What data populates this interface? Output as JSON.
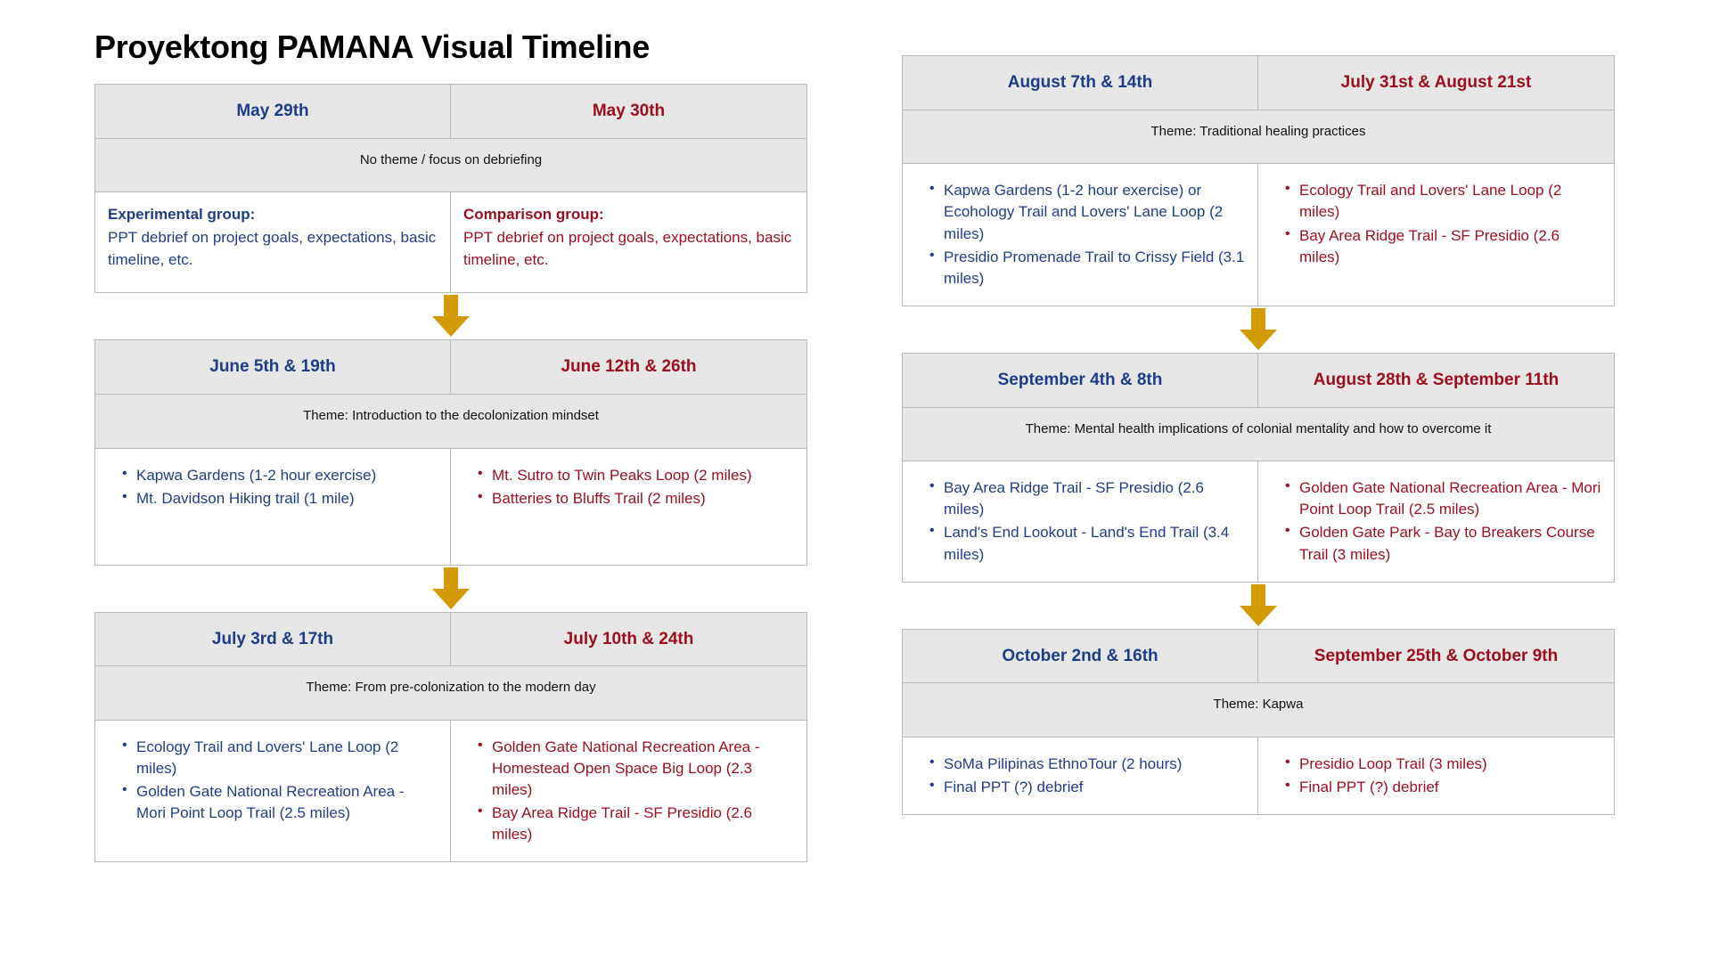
{
  "title": "Proyektong PAMANA Visual Timeline",
  "colors": {
    "experimental": "#1f3d87",
    "comparison": "#9c0d1e",
    "arrow": "#d29a05",
    "header_bg": "#e6e6e6",
    "border": "#b9b9b9"
  },
  "left_column": {
    "blocks": [
      {
        "header_experimental": "May 29th",
        "header_comparison": "May 30th",
        "theme": "No theme / focus on debriefing",
        "experimental_lead": "Experimental group:",
        "experimental_text": "PPT debrief on project goals, expectations, basic timeline, etc.",
        "comparison_lead": "Comparison group:",
        "comparison_text": "PPT debrief on project goals, expectations, basic timeline, etc."
      },
      {
        "header_experimental": "June 5th & 19th",
        "header_comparison": "June 12th & 26th",
        "theme": "Theme: Introduction to the decolonization mindset",
        "experimental_items": [
          "Kapwa Gardens (1-2 hour exercise)",
          "Mt. Davidson Hiking trail (1 mile)"
        ],
        "comparison_items": [
          "Mt. Sutro to Twin Peaks Loop (2 miles)",
          "Batteries to Bluffs Trail (2 miles)"
        ]
      },
      {
        "header_experimental": "July 3rd & 17th",
        "header_comparison": "July 10th & 24th",
        "theme": "Theme: From pre-colonization to the modern day",
        "experimental_items": [
          "Ecology Trail and Lovers' Lane Loop (2 miles)",
          "Golden Gate National Recreation Area - Mori Point Loop Trail (2.5 miles)"
        ],
        "comparison_items": [
          "Golden Gate National Recreation Area - Homestead Open Space Big Loop (2.3 miles)",
          "Bay Area Ridge Trail - SF Presidio (2.6 miles)"
        ]
      }
    ]
  },
  "right_column": {
    "blocks": [
      {
        "header_experimental": "August 7th & 14th",
        "header_comparison": "July 31st & August 21st",
        "theme": "Theme: Traditional healing practices",
        "experimental_items": [
          "Kapwa Gardens (1-2 hour exercise) or Ecohology Trail and Lovers' Lane Loop (2 miles)",
          "Presidio Promenade Trail to Crissy Field (3.1 miles)"
        ],
        "comparison_items": [
          "Ecology Trail and Lovers' Lane Loop (2 miles)",
          "Bay Area Ridge Trail - SF Presidio (2.6 miles)"
        ]
      },
      {
        "header_experimental": "September 4th & 8th",
        "header_comparison": "August 28th & September 11th",
        "theme": "Theme: Mental health implications of colonial mentality and how to overcome it",
        "experimental_items": [
          "Bay Area Ridge Trail - SF Presidio (2.6 miles)",
          "Land's End Lookout - Land's End Trail (3.4 miles)"
        ],
        "comparison_items": [
          "Golden Gate National Recreation Area - Mori Point Loop Trail (2.5 miles)",
          "Golden Gate Park - Bay to Breakers Course Trail (3 miles)"
        ]
      },
      {
        "header_experimental": "October 2nd & 16th",
        "header_comparison": "September 25th & October 9th",
        "theme": "Theme: Kapwa",
        "experimental_items": [
          "SoMa Pilipinas EthnoTour (2 hours)",
          "Final PPT (?) debrief"
        ],
        "comparison_items": [
          "Presidio Loop Trail (3 miles)",
          "Final PPT (?) debrief"
        ]
      }
    ]
  }
}
